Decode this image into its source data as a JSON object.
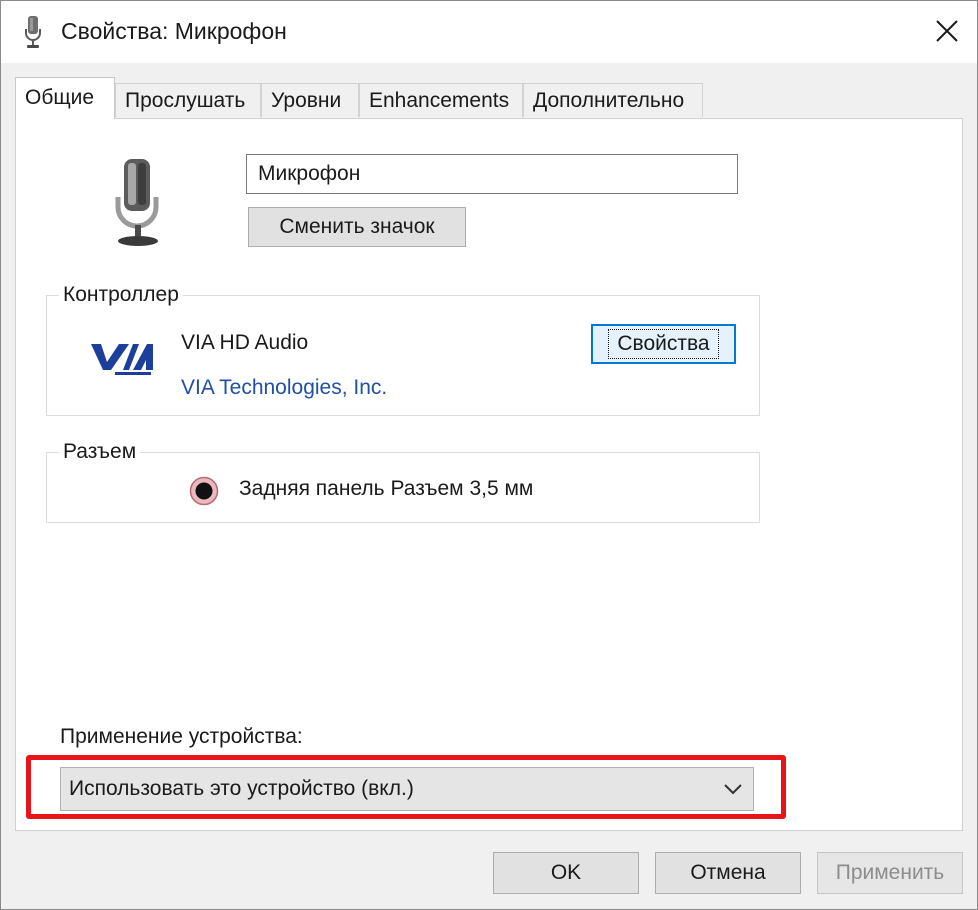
{
  "window": {
    "title": "Свойства: Микрофон",
    "icon": "microphone-icon",
    "close_icon": "close-icon"
  },
  "tabs": [
    {
      "label": "Общие",
      "active": true
    },
    {
      "label": "Прослушать",
      "active": false
    },
    {
      "label": "Уровни",
      "active": false
    },
    {
      "label": "Enhancements",
      "active": false
    },
    {
      "label": "Дополнительно",
      "active": false
    }
  ],
  "general": {
    "device_name": "Микрофон",
    "change_icon_label": "Сменить значок",
    "controller": {
      "group_title": "Контроллер",
      "name": "VIA HD Audio",
      "vendor": "VIA Technologies, Inc.",
      "properties_label": "Свойства",
      "logo": "via-logo"
    },
    "jack": {
      "group_title": "Разъем",
      "description": "Задняя панель Разъем 3,5 мм",
      "icon": "audio-jack-icon"
    },
    "usage": {
      "label": "Применение устройства:",
      "selected": "Использовать это устройство (вкл.)",
      "highlight_color": "#e8141a"
    }
  },
  "footer": {
    "ok_label": "OK",
    "cancel_label": "Отмена",
    "apply_label": "Применить",
    "apply_enabled": false
  },
  "colors": {
    "accent": "#0078d7",
    "link": "#1f4fa6"
  }
}
